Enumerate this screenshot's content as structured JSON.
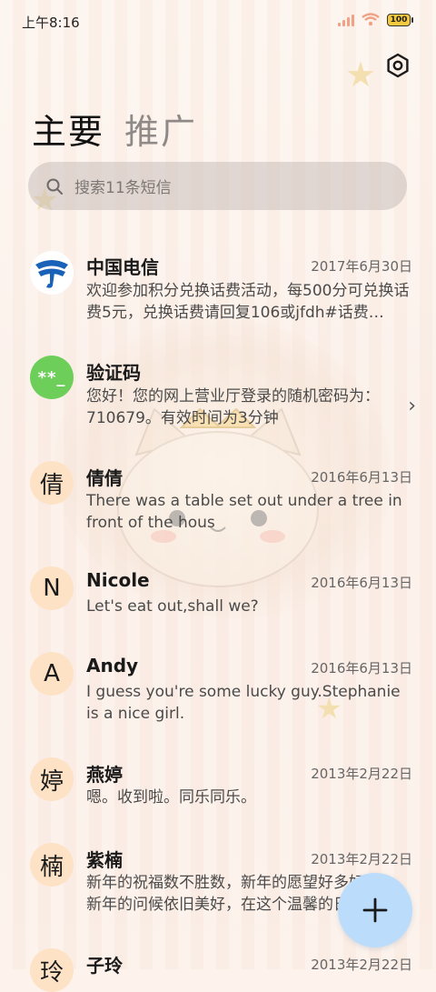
{
  "status_bar": {
    "time": "上午8:16",
    "battery": "100"
  },
  "tabs": [
    {
      "label": "主要",
      "active": true
    },
    {
      "label": "推广",
      "active": false
    }
  ],
  "search": {
    "placeholder": "搜索11条短信"
  },
  "conversations": [
    {
      "avatar": "telecom-logo",
      "name": "中国电信",
      "date": "2017年6月30日",
      "preview": "欢迎参加积分兑换话费活动，每500分可兑换话费5元，兑换话费请回复106或jfdh#话费…"
    },
    {
      "avatar": "**_",
      "name": "验证码",
      "date": "",
      "preview": "您好！您的网上营业厅登录的随机密码为：710679。有效时间为3分钟"
    },
    {
      "avatar": "倩",
      "name": "倩倩",
      "date": "2016年6月13日",
      "preview": "There was a table set out under a tree in front of the hous"
    },
    {
      "avatar": "N",
      "name": "Nicole",
      "date": "2016年6月13日",
      "preview": "Let's eat out,shall we?"
    },
    {
      "avatar": "A",
      "name": "Andy",
      "date": "2016年6月13日",
      "preview": "I guess you're some lucky guy.Stephanie is a nice girl."
    },
    {
      "avatar": "婷",
      "name": "燕婷",
      "date": "2013年2月22日",
      "preview": "嗯。收到啦。同乐同乐。"
    },
    {
      "avatar": "楠",
      "name": "紫楠",
      "date": "2013年2月22日",
      "preview": "新年的祝福数不胜数，新年的愿望好多好多，新年的问候依旧美好，在这个温馨的日子里"
    },
    {
      "avatar": "玲",
      "name": "子玲",
      "date": "2013年2月22日",
      "preview": ""
    }
  ],
  "colors": {
    "accent_fab": "#bcdcfb",
    "avatar_bg": "#fde2c6",
    "verify_green": "#6dcf5a"
  }
}
